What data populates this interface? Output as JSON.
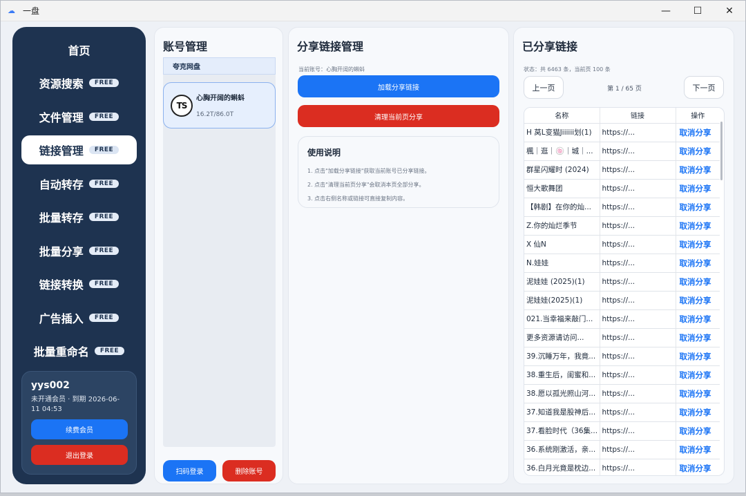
{
  "window": {
    "title": "一盘",
    "controls": {
      "minimize": "—",
      "maximize": "☐",
      "close": "✕"
    }
  },
  "sidebar": {
    "badge": "FREE",
    "items": [
      {
        "label": "首页",
        "free": false,
        "active": false
      },
      {
        "label": "资源搜索",
        "free": true,
        "active": false
      },
      {
        "label": "文件管理",
        "free": true,
        "active": false
      },
      {
        "label": "链接管理",
        "free": true,
        "active": true
      },
      {
        "label": "自动转存",
        "free": true,
        "active": false
      },
      {
        "label": "批量转存",
        "free": true,
        "active": false
      },
      {
        "label": "批量分享",
        "free": true,
        "active": false
      },
      {
        "label": "链接转换",
        "free": true,
        "active": false
      },
      {
        "label": "广告插入",
        "free": true,
        "active": false
      },
      {
        "label": "批量重命名",
        "free": true,
        "active": false
      }
    ],
    "user": {
      "name": "yys002",
      "status": "未开通会员 · 到期 2026-06-11 04:53",
      "renew_label": "续费会员",
      "logout_label": "退出登录"
    }
  },
  "account_panel": {
    "title": "账号管理",
    "tab": "夸克网盘",
    "account": {
      "logo": "TS",
      "name": "心胸开阔的蝌蚪",
      "storage": "16.2T/86.0T"
    },
    "scan_login_label": "扫码登录",
    "delete_label": "删除账号"
  },
  "share_panel": {
    "title": "分享链接管理",
    "current_account": "当前账号：心胸开阔的蝌蚪",
    "load_label": "加载分享链接",
    "clear_label": "清理当前页分享",
    "usage": {
      "title": "使用说明",
      "lines": [
        "1. 点击\"加载分享链接\"获取当前账号已分享链接。",
        "2. 点击\"清理当前页分享\"会取消本页全部分享。",
        "3. 点击右侧名称或链接可直接复制内容。"
      ]
    }
  },
  "links_panel": {
    "title": "已分享链接",
    "status": "状态：共 6463 条，当前页 100 条",
    "prev_label": "上一页",
    "next_label": "下一页",
    "page_info": "第 1 / 65 页",
    "columns": [
      "名称",
      "链接",
      "操作"
    ],
    "rows": [
      {
        "name": "H 莴L变猫Jiiiiii划(1)",
        "link": "https://...",
        "action": "取消分享"
      },
      {
        "name": "楓｜逛｜🍥｜城｜...",
        "link": "https://...",
        "action": "取消分享"
      },
      {
        "name": "群星闪耀时 (2024)",
        "link": "https://...",
        "action": "取消分享"
      },
      {
        "name": "恒大歌舞团",
        "link": "https://...",
        "action": "取消分享"
      },
      {
        "name": "【韩剧】在你的灿...",
        "link": "https://...",
        "action": "取消分享"
      },
      {
        "name": "Z.你的灿烂季节",
        "link": "https://...",
        "action": "取消分享"
      },
      {
        "name": "X 仙N",
        "link": "https://...",
        "action": "取消分享"
      },
      {
        "name": "N.娃娃",
        "link": "https://...",
        "action": "取消分享"
      },
      {
        "name": "泥娃娃 (2025)(1)",
        "link": "https://...",
        "action": "取消分享"
      },
      {
        "name": "泥娃娃(2025)(1)",
        "link": "https://...",
        "action": "取消分享"
      },
      {
        "name": "021.当幸福来敲门...",
        "link": "https://...",
        "action": "取消分享"
      },
      {
        "name": "更多资源请访问...",
        "link": "https://...",
        "action": "取消分享"
      },
      {
        "name": "39.沉睡万年，我竟...",
        "link": "https://...",
        "action": "取消分享"
      },
      {
        "name": "38.重生后，闺蜜和...",
        "link": "https://...",
        "action": "取消分享"
      },
      {
        "name": "38.愿以孤光照山河...",
        "link": "https://...",
        "action": "取消分享"
      },
      {
        "name": "37.知道我是股神后...",
        "link": "https://...",
        "action": "取消分享"
      },
      {
        "name": "37.看脸时代（36集...",
        "link": "https://...",
        "action": "取消分享"
      },
      {
        "name": "36.系统刚激活，亲...",
        "link": "https://...",
        "action": "取消分享"
      },
      {
        "name": "36.白月光竟是枕边...",
        "link": "https://...",
        "action": "取消分享"
      }
    ]
  }
}
